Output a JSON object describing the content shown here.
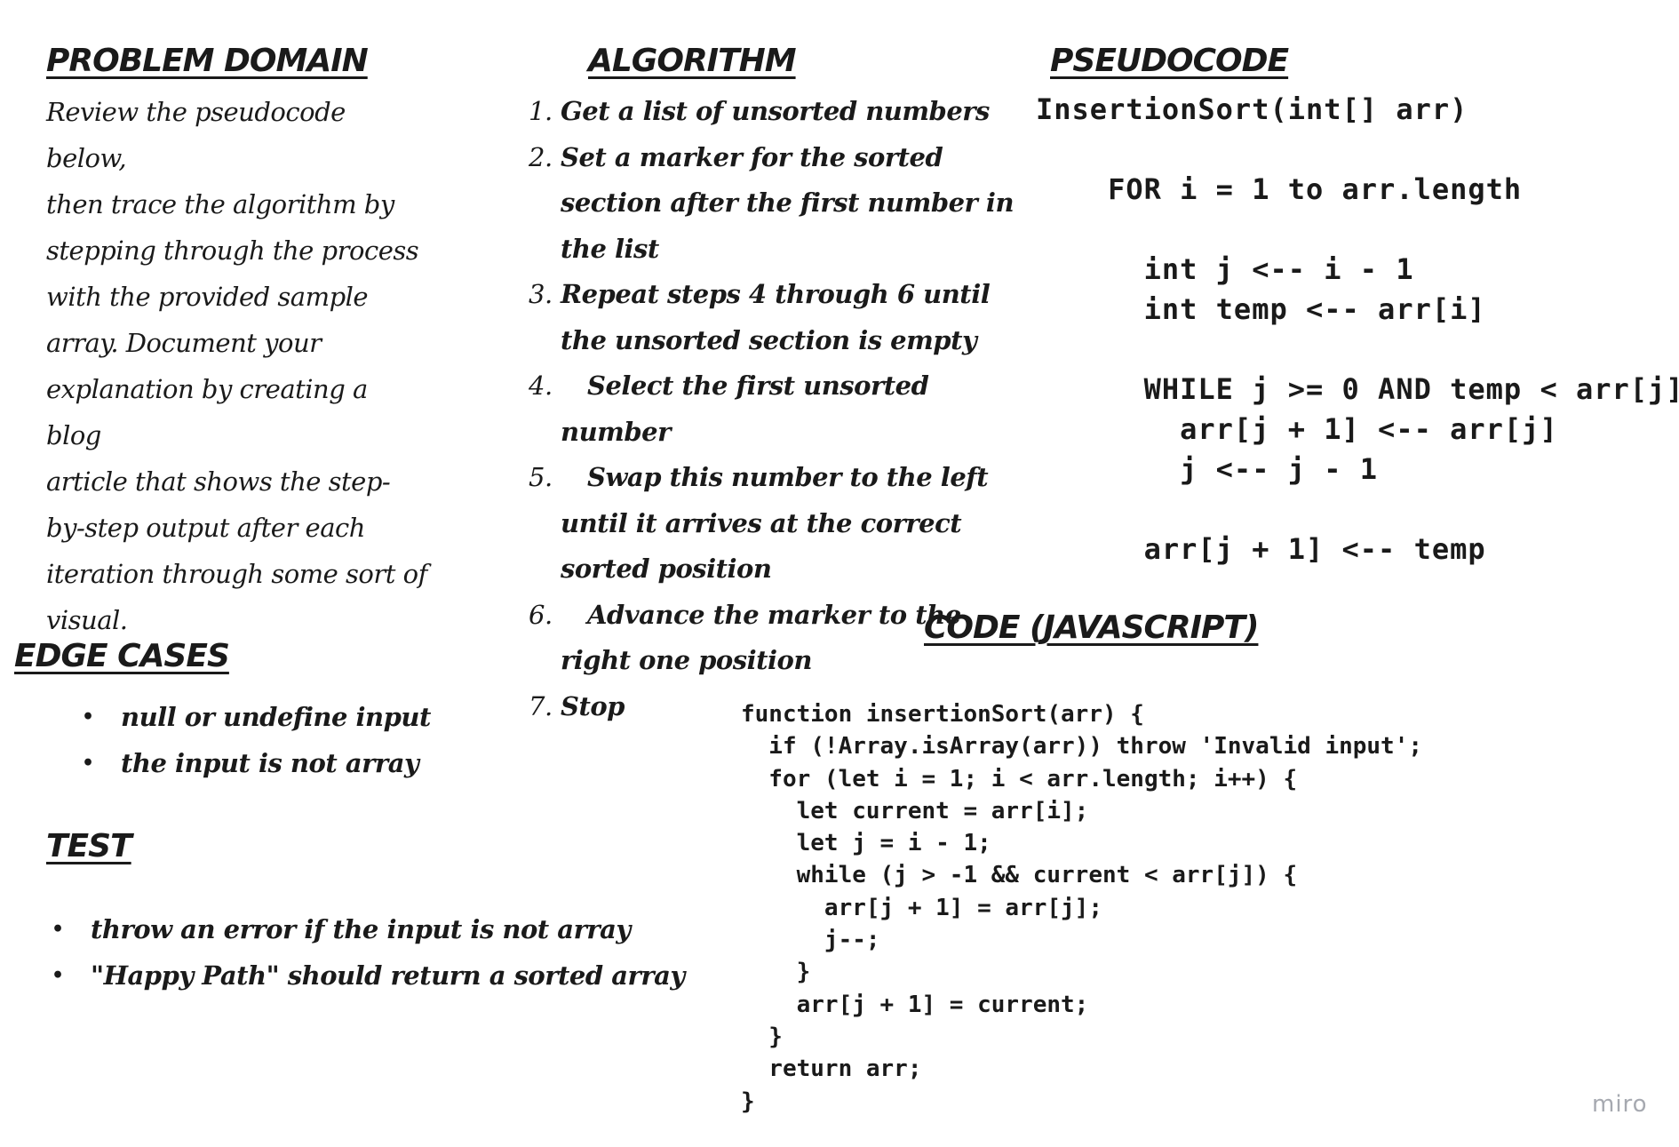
{
  "problem_domain": {
    "title": "PROBLEM DOMAIN",
    "lines": [
      "Review the pseudocode below,",
      "then trace the algorithm by",
      "stepping through the process",
      "with the provided sample",
      "array. Document your",
      "explanation by creating a blog",
      "article that shows the step-",
      "by-step output after each",
      "iteration through some sort of",
      "visual."
    ]
  },
  "algorithm": {
    "title": "ALGORITHM",
    "steps": [
      {
        "num": "1.",
        "text": "Get a list of unsorted numbers"
      },
      {
        "num": "2.",
        "text": "Set a marker for the sorted section after the first number in the list"
      },
      {
        "num": "3.",
        "text": "Repeat steps 4 through 6 until the unsorted section is empty"
      },
      {
        "num": "4.",
        "text": "Select the first unsorted number"
      },
      {
        "num": "5.",
        "text": "Swap this number to the left until it arrives at the correct sorted position"
      },
      {
        "num": "6.",
        "text": "Advance the marker to the right one position"
      },
      {
        "num": "7.",
        "text": "Stop"
      }
    ]
  },
  "pseudocode": {
    "title": "PSEUDOCODE",
    "text": "InsertionSort(int[] arr)\n\n    FOR i = 1 to arr.length\n\n      int j <-- i - 1\n      int temp <-- arr[i]\n\n      WHILE j >= 0 AND temp < arr[j]\n        arr[j + 1] <-- arr[j]\n        j <-- j - 1\n\n      arr[j + 1] <-- temp"
  },
  "edge_cases": {
    "title": "EDGE CASES",
    "items": [
      "null or undefine input",
      "the input is not array"
    ]
  },
  "test": {
    "title": "TEST",
    "items": [
      "throw an error if the input is not array",
      "\"Happy Path\"  should return a sorted array"
    ]
  },
  "code": {
    "title": "CODE (JAVASCRIPT)",
    "text": "function insertionSort(arr) {\n  if (!Array.isArray(arr)) throw 'Invalid input';\n  for (let i = 1; i < arr.length; i++) {\n    let current = arr[i];\n    let j = i - 1;\n    while (j > -1 && current < arr[j]) {\n      arr[j + 1] = arr[j];\n      j--;\n    }\n    arr[j + 1] = current;\n  }\n  return arr;\n}"
  },
  "watermark": "miro"
}
